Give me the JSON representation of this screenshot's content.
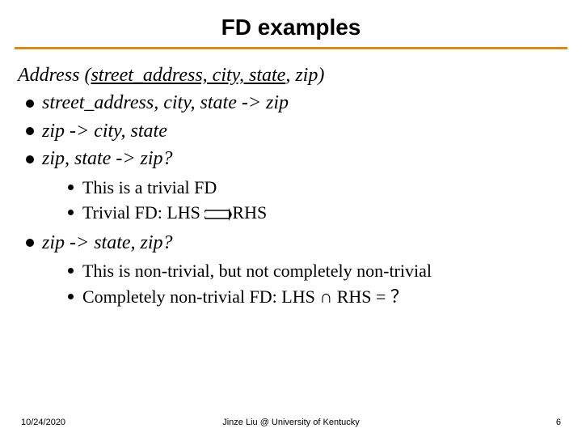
{
  "title": "FD examples",
  "schema": {
    "relation": "Address",
    "open": " (",
    "key": "street_address, city, state",
    "rest": ", zip)",
    "close": ""
  },
  "bullets": {
    "b1": "street_address, city, state -> zip",
    "b2": "zip -> city, state",
    "b3": "zip, state -> zip?",
    "b3_sub1": "This is a trivial FD",
    "b3_sub2_prefix": "Trivial FD: LHS ",
    "b3_sub2_suffix": "RHS",
    "b4": "zip -> state, zip?",
    "b4_sub1": "This is non-trivial, but not completely non-trivial",
    "b4_sub2": "Completely non-trivial FD: LHS ∩ RHS = ？"
  },
  "footer": {
    "date": "10/24/2020",
    "mid": "Jinze Liu @ University of Kentucky",
    "num": "6"
  }
}
